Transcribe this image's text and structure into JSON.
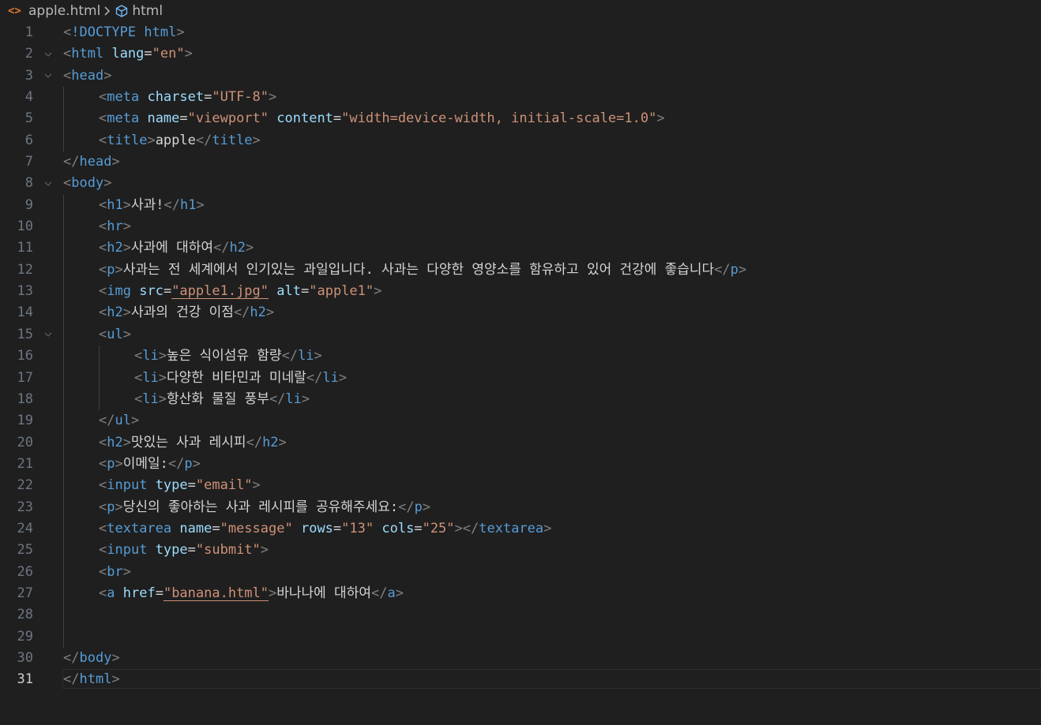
{
  "breadcrumb": {
    "file": "apple.html",
    "symbol": "html",
    "file_icon": "html-file-icon",
    "symbol_icon": "cube-icon",
    "separator_icon": "chevron-right-icon"
  },
  "editor": {
    "current_line": 31,
    "colors": {
      "background": "#1f1f1f",
      "punctuation": "#808080",
      "tag": "#569cd6",
      "attribute": "#9cdcfe",
      "string": "#ce9178",
      "text": "#d4d4d4",
      "line_number": "#6e7681",
      "line_number_active": "#cccccc"
    },
    "lines": [
      {
        "n": "1",
        "fold": false,
        "indent": 0,
        "tokens": [
          [
            "p",
            "<"
          ],
          [
            "tag",
            "!DOCTYPE"
          ],
          [
            "text",
            " "
          ],
          [
            "tag",
            "html"
          ],
          [
            "p",
            ">"
          ]
        ]
      },
      {
        "n": "2",
        "fold": true,
        "indent": 0,
        "tokens": [
          [
            "p",
            "<"
          ],
          [
            "tag",
            "html"
          ],
          [
            "text",
            " "
          ],
          [
            "attr",
            "lang"
          ],
          [
            "eq",
            "="
          ],
          [
            "str",
            "\"en\""
          ],
          [
            "p",
            ">"
          ]
        ]
      },
      {
        "n": "3",
        "fold": true,
        "indent": 0,
        "tokens": [
          [
            "p",
            "<"
          ],
          [
            "tag",
            "head"
          ],
          [
            "p",
            ">"
          ]
        ]
      },
      {
        "n": "4",
        "fold": false,
        "indent": 1,
        "tokens": [
          [
            "p",
            "<"
          ],
          [
            "tag",
            "meta"
          ],
          [
            "text",
            " "
          ],
          [
            "attr",
            "charset"
          ],
          [
            "eq",
            "="
          ],
          [
            "str",
            "\"UTF-8\""
          ],
          [
            "p",
            ">"
          ]
        ]
      },
      {
        "n": "5",
        "fold": false,
        "indent": 1,
        "tokens": [
          [
            "p",
            "<"
          ],
          [
            "tag",
            "meta"
          ],
          [
            "text",
            " "
          ],
          [
            "attr",
            "name"
          ],
          [
            "eq",
            "="
          ],
          [
            "str",
            "\"viewport\""
          ],
          [
            "text",
            " "
          ],
          [
            "attr",
            "content"
          ],
          [
            "eq",
            "="
          ],
          [
            "str",
            "\"width=device-width, initial-scale=1.0\""
          ],
          [
            "p",
            ">"
          ]
        ]
      },
      {
        "n": "6",
        "fold": false,
        "indent": 1,
        "tokens": [
          [
            "p",
            "<"
          ],
          [
            "tag",
            "title"
          ],
          [
            "p",
            ">"
          ],
          [
            "text",
            "apple"
          ],
          [
            "p",
            "</"
          ],
          [
            "tag",
            "title"
          ],
          [
            "p",
            ">"
          ]
        ]
      },
      {
        "n": "7",
        "fold": false,
        "indent": 0,
        "tokens": [
          [
            "p",
            "</"
          ],
          [
            "tag",
            "head"
          ],
          [
            "p",
            ">"
          ]
        ]
      },
      {
        "n": "8",
        "fold": true,
        "indent": 0,
        "tokens": [
          [
            "p",
            "<"
          ],
          [
            "tag",
            "body"
          ],
          [
            "p",
            ">"
          ]
        ]
      },
      {
        "n": "9",
        "fold": false,
        "indent": 1,
        "tokens": [
          [
            "p",
            "<"
          ],
          [
            "tag",
            "h1"
          ],
          [
            "p",
            ">"
          ],
          [
            "text",
            "사과!"
          ],
          [
            "p",
            "</"
          ],
          [
            "tag",
            "h1"
          ],
          [
            "p",
            ">"
          ]
        ]
      },
      {
        "n": "10",
        "fold": false,
        "indent": 1,
        "tokens": [
          [
            "p",
            "<"
          ],
          [
            "tag",
            "hr"
          ],
          [
            "p",
            ">"
          ]
        ]
      },
      {
        "n": "11",
        "fold": false,
        "indent": 1,
        "tokens": [
          [
            "p",
            "<"
          ],
          [
            "tag",
            "h2"
          ],
          [
            "p",
            ">"
          ],
          [
            "text",
            "사과에 대하여"
          ],
          [
            "p",
            "</"
          ],
          [
            "tag",
            "h2"
          ],
          [
            "p",
            ">"
          ]
        ]
      },
      {
        "n": "12",
        "fold": false,
        "indent": 1,
        "tokens": [
          [
            "p",
            "<"
          ],
          [
            "tag",
            "p"
          ],
          [
            "p",
            ">"
          ],
          [
            "text",
            "사과는 전 세계에서 인기있는 과일입니다. 사과는 다양한 영양소를 함유하고 있어 건강에 좋습니다"
          ],
          [
            "p",
            "</"
          ],
          [
            "tag",
            "p"
          ],
          [
            "p",
            ">"
          ]
        ]
      },
      {
        "n": "13",
        "fold": false,
        "indent": 1,
        "tokens": [
          [
            "p",
            "<"
          ],
          [
            "tag",
            "img"
          ],
          [
            "text",
            " "
          ],
          [
            "attr",
            "src"
          ],
          [
            "eq",
            "="
          ],
          [
            "link",
            "\"apple1.jpg\""
          ],
          [
            "text",
            " "
          ],
          [
            "attr",
            "alt"
          ],
          [
            "eq",
            "="
          ],
          [
            "str",
            "\"apple1\""
          ],
          [
            "p",
            ">"
          ]
        ]
      },
      {
        "n": "14",
        "fold": false,
        "indent": 1,
        "tokens": [
          [
            "p",
            "<"
          ],
          [
            "tag",
            "h2"
          ],
          [
            "p",
            ">"
          ],
          [
            "text",
            "사과의 건강 이점"
          ],
          [
            "p",
            "</"
          ],
          [
            "tag",
            "h2"
          ],
          [
            "p",
            ">"
          ]
        ]
      },
      {
        "n": "15",
        "fold": true,
        "indent": 1,
        "tokens": [
          [
            "p",
            "<"
          ],
          [
            "tag",
            "ul"
          ],
          [
            "p",
            ">"
          ]
        ]
      },
      {
        "n": "16",
        "fold": false,
        "indent": 2,
        "tokens": [
          [
            "p",
            "<"
          ],
          [
            "tag",
            "li"
          ],
          [
            "p",
            ">"
          ],
          [
            "text",
            "높은 식이섬유 함량"
          ],
          [
            "p",
            "</"
          ],
          [
            "tag",
            "li"
          ],
          [
            "p",
            ">"
          ]
        ]
      },
      {
        "n": "17",
        "fold": false,
        "indent": 2,
        "tokens": [
          [
            "p",
            "<"
          ],
          [
            "tag",
            "li"
          ],
          [
            "p",
            ">"
          ],
          [
            "text",
            "다양한 비타민과 미네랄"
          ],
          [
            "p",
            "</"
          ],
          [
            "tag",
            "li"
          ],
          [
            "p",
            ">"
          ]
        ]
      },
      {
        "n": "18",
        "fold": false,
        "indent": 2,
        "tokens": [
          [
            "p",
            "<"
          ],
          [
            "tag",
            "li"
          ],
          [
            "p",
            ">"
          ],
          [
            "text",
            "항산화 물질 풍부"
          ],
          [
            "p",
            "</"
          ],
          [
            "tag",
            "li"
          ],
          [
            "p",
            ">"
          ]
        ]
      },
      {
        "n": "19",
        "fold": false,
        "indent": 1,
        "tokens": [
          [
            "p",
            "</"
          ],
          [
            "tag",
            "ul"
          ],
          [
            "p",
            ">"
          ]
        ]
      },
      {
        "n": "20",
        "fold": false,
        "indent": 1,
        "tokens": [
          [
            "p",
            "<"
          ],
          [
            "tag",
            "h2"
          ],
          [
            "p",
            ">"
          ],
          [
            "text",
            "맛있는 사과 레시피"
          ],
          [
            "p",
            "</"
          ],
          [
            "tag",
            "h2"
          ],
          [
            "p",
            ">"
          ]
        ]
      },
      {
        "n": "21",
        "fold": false,
        "indent": 1,
        "tokens": [
          [
            "p",
            "<"
          ],
          [
            "tag",
            "p"
          ],
          [
            "p",
            ">"
          ],
          [
            "text",
            "이메일:"
          ],
          [
            "p",
            "</"
          ],
          [
            "tag",
            "p"
          ],
          [
            "p",
            ">"
          ]
        ]
      },
      {
        "n": "22",
        "fold": false,
        "indent": 1,
        "tokens": [
          [
            "p",
            "<"
          ],
          [
            "tag",
            "input"
          ],
          [
            "text",
            " "
          ],
          [
            "attr",
            "type"
          ],
          [
            "eq",
            "="
          ],
          [
            "str",
            "\"email\""
          ],
          [
            "p",
            ">"
          ]
        ]
      },
      {
        "n": "23",
        "fold": false,
        "indent": 1,
        "tokens": [
          [
            "p",
            "<"
          ],
          [
            "tag",
            "p"
          ],
          [
            "p",
            ">"
          ],
          [
            "text",
            "당신의 좋아하는 사과 레시피를 공유해주세요:"
          ],
          [
            "p",
            "</"
          ],
          [
            "tag",
            "p"
          ],
          [
            "p",
            ">"
          ]
        ]
      },
      {
        "n": "24",
        "fold": false,
        "indent": 1,
        "tokens": [
          [
            "p",
            "<"
          ],
          [
            "tag",
            "textarea"
          ],
          [
            "text",
            " "
          ],
          [
            "attr",
            "name"
          ],
          [
            "eq",
            "="
          ],
          [
            "str",
            "\"message\""
          ],
          [
            "text",
            " "
          ],
          [
            "attr",
            "rows"
          ],
          [
            "eq",
            "="
          ],
          [
            "str",
            "\"13\""
          ],
          [
            "text",
            " "
          ],
          [
            "attr",
            "cols"
          ],
          [
            "eq",
            "="
          ],
          [
            "str",
            "\"25\""
          ],
          [
            "p",
            "></"
          ],
          [
            "tag",
            "textarea"
          ],
          [
            "p",
            ">"
          ]
        ]
      },
      {
        "n": "25",
        "fold": false,
        "indent": 1,
        "tokens": [
          [
            "p",
            "<"
          ],
          [
            "tag",
            "input"
          ],
          [
            "text",
            " "
          ],
          [
            "attr",
            "type"
          ],
          [
            "eq",
            "="
          ],
          [
            "str",
            "\"submit\""
          ],
          [
            "p",
            ">"
          ]
        ]
      },
      {
        "n": "26",
        "fold": false,
        "indent": 1,
        "tokens": [
          [
            "p",
            "<"
          ],
          [
            "tag",
            "br"
          ],
          [
            "p",
            ">"
          ]
        ]
      },
      {
        "n": "27",
        "fold": false,
        "indent": 1,
        "tokens": [
          [
            "p",
            "<"
          ],
          [
            "tag",
            "a"
          ],
          [
            "text",
            " "
          ],
          [
            "attr",
            "href"
          ],
          [
            "eq",
            "="
          ],
          [
            "link",
            "\"banana.html\""
          ],
          [
            "p",
            ">"
          ],
          [
            "text",
            "바나나에 대하여"
          ],
          [
            "p",
            "</"
          ],
          [
            "tag",
            "a"
          ],
          [
            "p",
            ">"
          ]
        ]
      },
      {
        "n": "28",
        "fold": false,
        "indent": 1,
        "tokens": []
      },
      {
        "n": "29",
        "fold": false,
        "indent": 1,
        "tokens": []
      },
      {
        "n": "30",
        "fold": false,
        "indent": 0,
        "tokens": [
          [
            "p",
            "</"
          ],
          [
            "tag",
            "body"
          ],
          [
            "p",
            ">"
          ]
        ]
      },
      {
        "n": "31",
        "fold": false,
        "indent": 0,
        "tokens": [
          [
            "p",
            "</"
          ],
          [
            "tag",
            "html"
          ],
          [
            "p",
            ">"
          ]
        ]
      }
    ]
  }
}
